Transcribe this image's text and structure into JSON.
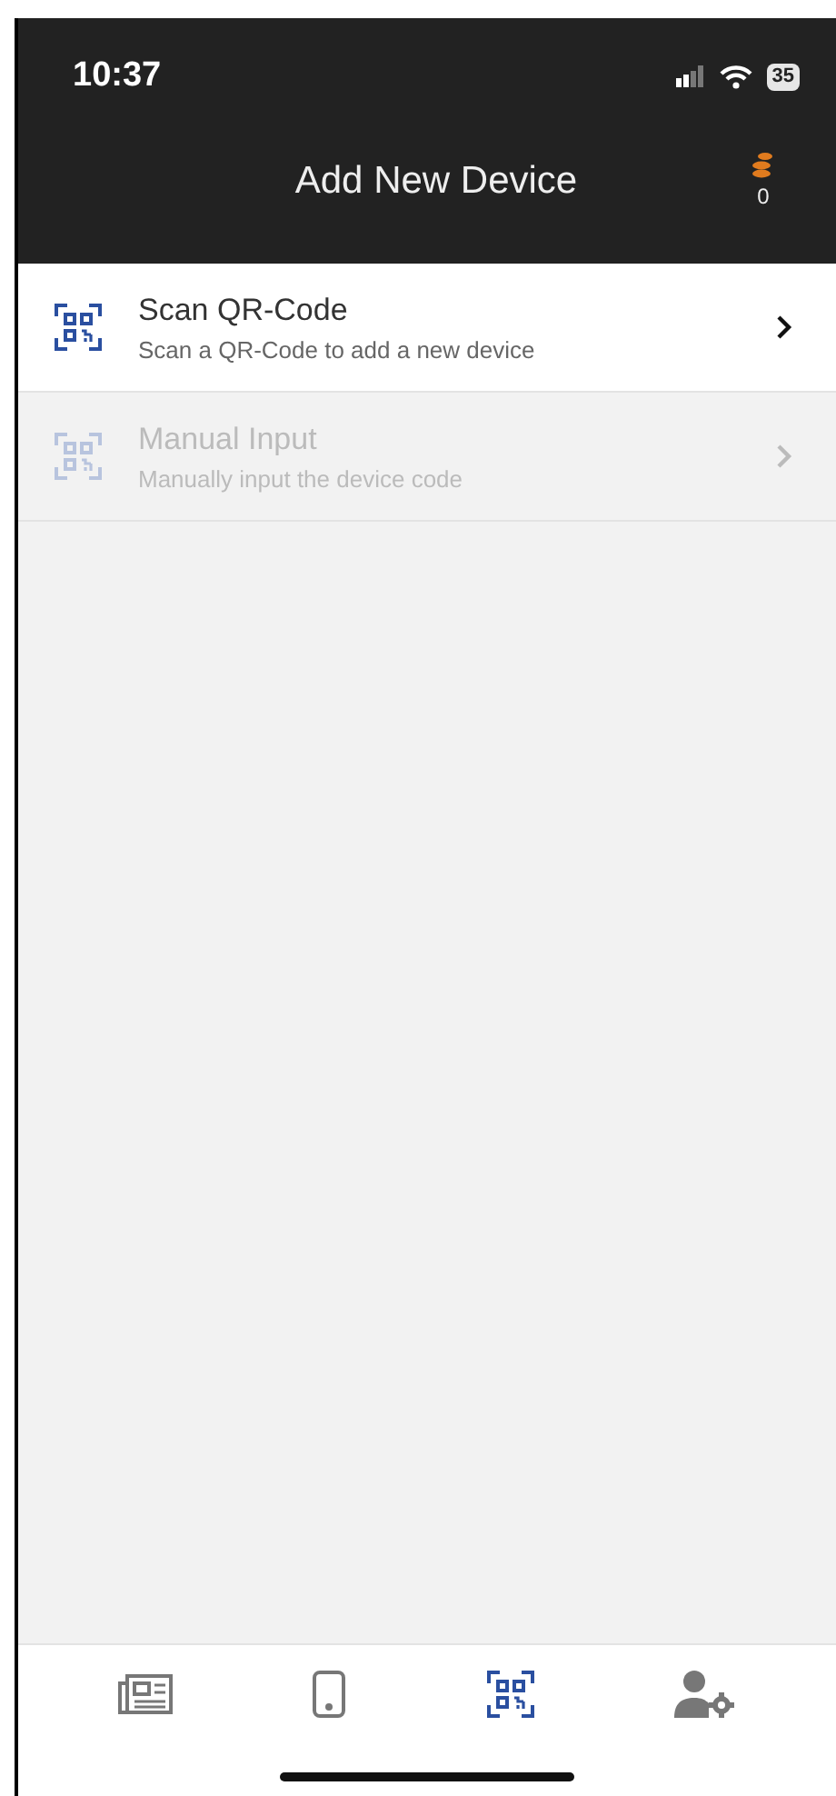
{
  "status_bar": {
    "time": "10:37",
    "battery": "35"
  },
  "header": {
    "title": "Add New Device",
    "coins": "0"
  },
  "options": [
    {
      "title": "Scan QR-Code",
      "subtitle": "Scan a QR-Code to add a new device",
      "disabled": false
    },
    {
      "title": "Manual Input",
      "subtitle": "Manually input the device code",
      "disabled": true
    }
  ],
  "tab_bar": [
    {
      "kind": "news",
      "selected": false
    },
    {
      "kind": "device",
      "selected": false
    },
    {
      "kind": "qr",
      "selected": true
    },
    {
      "kind": "account",
      "selected": false
    }
  ]
}
